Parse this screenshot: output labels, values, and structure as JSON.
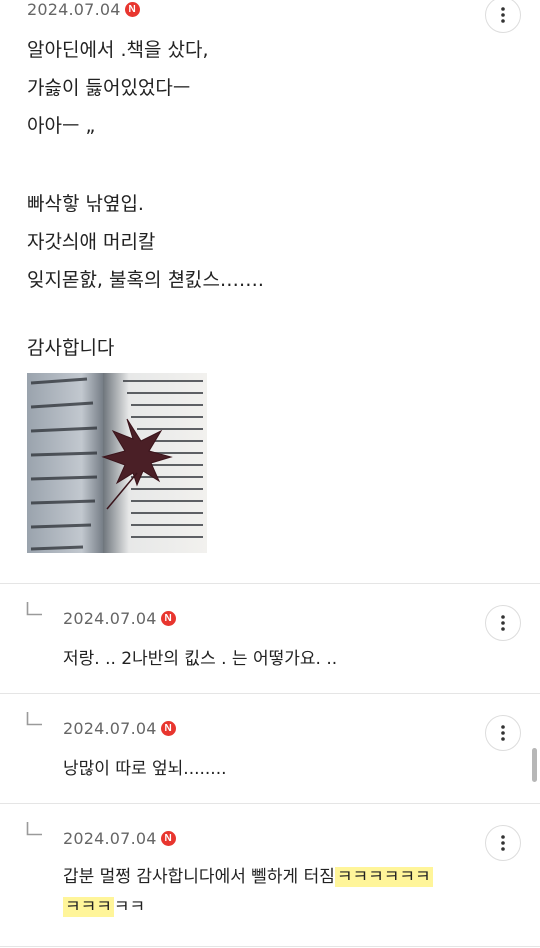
{
  "main_comment": {
    "date": "2024.07.04",
    "badge": "N",
    "lines": [
      "알아딘에서 .책을 샀다,",
      "가슳이 듫어있었다ㅡ",
      "아아ㅡ „",
      "",
      "빠삭핳 낚옆입.",
      "자갓싀애 머리칼",
      "잊지몯핤, 불혹의 쳗킰스…….",
      "",
      ""
    ],
    "thanks": "감사합니다",
    "image_icon": "book-with-maple-leaf-photo"
  },
  "replies": [
    {
      "date": "2024.07.04",
      "badge": "N",
      "text": "저랑. .. 2나반의 킶스 . 는 어떻가요. .."
    },
    {
      "date": "2024.07.04",
      "badge": "N",
      "text": "낭많이 따로 엎뇌........"
    },
    {
      "date": "2024.07.04",
      "badge": "N",
      "text_plain": "갑분 멀쩡 감사합니다에서 뻴하게 터짐",
      "text_hl_1": "ㅋㅋㅋㅋㅋㅋ",
      "text_hl_2": "ㅋㅋㅋ",
      "text_tail": "ㅋㅋ"
    }
  ],
  "colors": {
    "badge": "#e8362f",
    "highlight": "#fff59a",
    "date": "#666666"
  }
}
